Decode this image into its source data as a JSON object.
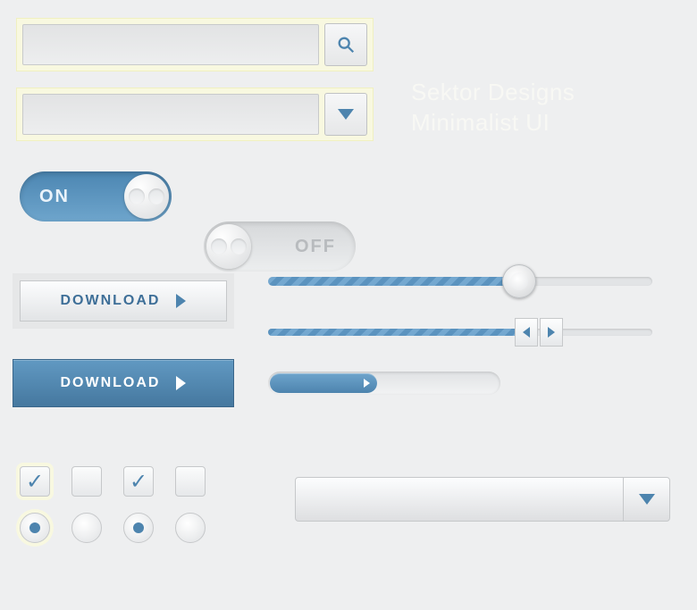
{
  "title": {
    "line1": "Sektor Designs",
    "line2": "Minimalist UI"
  },
  "search": {
    "value": "",
    "placeholder": ""
  },
  "dropdown1": {
    "value": ""
  },
  "toggles": {
    "on_label": "ON",
    "off_label": "OFF"
  },
  "buttons": {
    "download_light": "DOWNLOAD",
    "download_blue": "DOWNLOAD"
  },
  "sliders": {
    "slider1_percent": 65,
    "slider2_percent": 67
  },
  "pill_progress": {
    "percent": 46
  },
  "checkboxes": [
    {
      "checked": true,
      "highlighted": true
    },
    {
      "checked": false,
      "highlighted": false
    },
    {
      "checked": true,
      "highlighted": false
    },
    {
      "checked": false,
      "highlighted": false
    }
  ],
  "radios": [
    {
      "checked": true,
      "highlighted": true
    },
    {
      "checked": false,
      "highlighted": false
    },
    {
      "checked": true,
      "highlighted": false
    },
    {
      "checked": false,
      "highlighted": false
    }
  ],
  "big_select": {
    "value": ""
  },
  "colors": {
    "accent": "#4d84ae",
    "bg": "#eeeff0"
  }
}
